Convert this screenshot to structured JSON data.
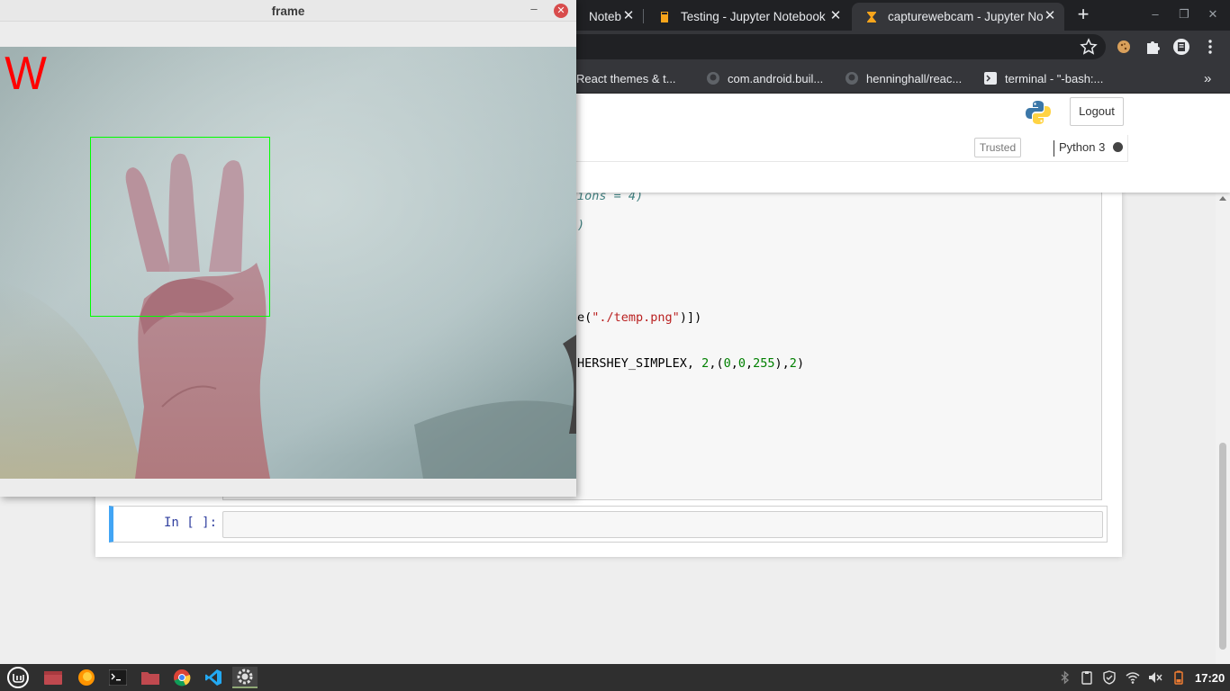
{
  "browser": {
    "tabs": [
      {
        "title": "Noteb",
        "icon": "jupyter-book-icon",
        "active": false
      },
      {
        "title": "Testing - Jupyter Notebook",
        "icon": "book-icon",
        "active": false
      },
      {
        "title": "capturewebcam - Jupyter No",
        "icon": "hourglass-icon",
        "active": true
      }
    ],
    "tab_close": "✕",
    "new_tab": "+",
    "bookmarks": [
      {
        "label": "React themes & t...",
        "icon": "react-icon"
      },
      {
        "label": "com.android.buil...",
        "icon": "github-icon"
      },
      {
        "label": "henninghall/reac...",
        "icon": "github-icon"
      },
      {
        "label": "terminal - \"-bash:...",
        "icon": "terminal-icon"
      }
    ],
    "bookmarks_more": "»"
  },
  "jupyter": {
    "logout_label": "Logout",
    "trusted_label": "Trusted",
    "kernel_name": "Python 3",
    "empty_cell_prompt": "In [ ]:"
  },
  "code": {
    "line1": "ions = 4)",
    "line2": ")",
    "line3_a": "e(",
    "line3_str": "\"./temp.png\"",
    "line3_b": ")])",
    "line4_a": "HERSHEY_SIMPLEX, ",
    "line4_n1": "2",
    "line4_b": ",(",
    "line4_n2": "0",
    "line4_c": ",",
    "line4_n3": "0",
    "line4_d": ",",
    "line4_n4": "255",
    "line4_e": "),",
    "line4_n5": "2",
    "line4_f": ")"
  },
  "frame_window": {
    "title": "frame",
    "minimize": "–",
    "close": "✕",
    "prediction": "W"
  },
  "taskbar": {
    "apps": [
      "mint-menu-icon",
      "files-red-icon",
      "firefox-icon",
      "terminal-icon",
      "folder-icon",
      "chrome-icon",
      "vscode-icon",
      "settings-icon"
    ],
    "clock": "17:20"
  },
  "colors": {
    "prediction": "#ff0000",
    "roi_box": "#00ff00",
    "chrome_dark": "#202124",
    "jupyter_blue": "#42a5f5"
  }
}
